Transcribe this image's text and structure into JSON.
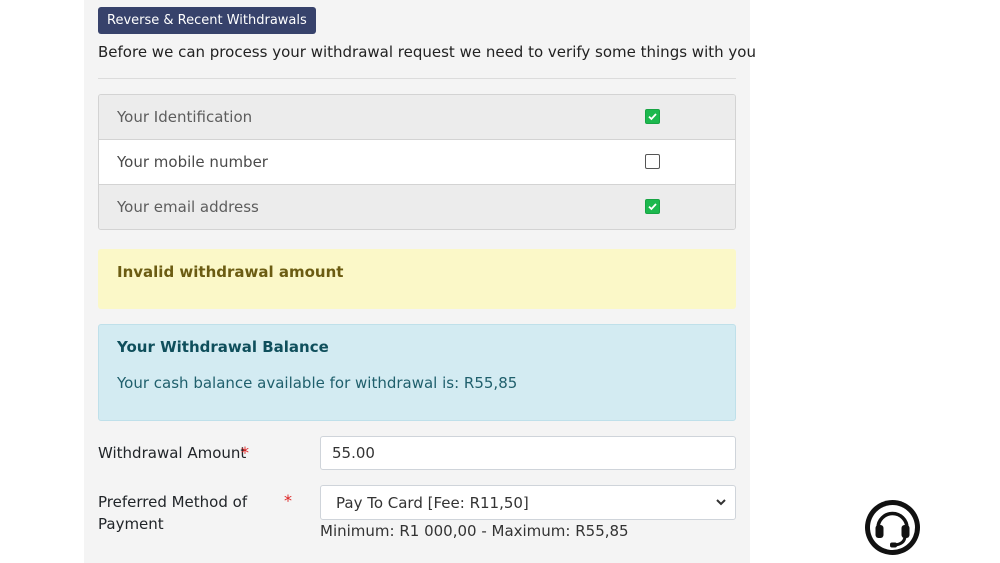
{
  "header": {
    "reverse_button_label": "Reverse & Recent Withdrawals"
  },
  "intro_text": "Before we can process your withdrawal request we need to verify some things with you",
  "verification_items": [
    {
      "label": "Your Identification",
      "checked": true
    },
    {
      "label": "Your mobile number",
      "checked": false
    },
    {
      "label": "Your email address",
      "checked": true
    }
  ],
  "warning_message": "Invalid withdrawal amount",
  "balance_alert": {
    "title": "Your Withdrawal Balance",
    "text": "Your cash balance available for withdrawal is: R55,85"
  },
  "form": {
    "amount_label": "Withdrawal Amount",
    "required_marker": "*",
    "amount_value": "55.00",
    "method_label_line1": "Preferred Method of",
    "method_label_line2": "Payment",
    "method_selected": "Pay To Card [Fee: R11,50]",
    "limits_text": "Minimum: R1 000,00 - Maximum: R55,85"
  },
  "colors": {
    "button_bg": "#37426b",
    "check_on": "#1cb84e",
    "warning_bg": "#fbf8c8",
    "info_bg": "#d3ebf2",
    "required": "#dd2222"
  },
  "icons": {
    "support": "headset-support-icon",
    "select_arrow": "chevron-down-icon",
    "check": "checkmark-icon"
  }
}
